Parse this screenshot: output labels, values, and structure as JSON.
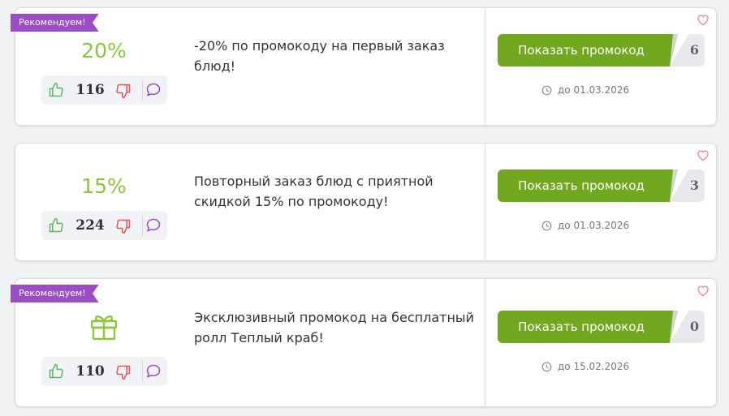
{
  "colors": {
    "accent_green": "#72a820",
    "discount_green": "#8cc63f",
    "ribbon_purple": "#9b4dc5",
    "like_green": "#5cb85c",
    "dislike_red": "#e05555",
    "comment_purple": "#9b4dc5",
    "heart_pink": "#e88a8a"
  },
  "coupons": [
    {
      "ribbon": "Рекомендуем!",
      "discount": "20%",
      "icon": "",
      "likes": "116",
      "description": "-20% по промокоду на первый заказ блюд!",
      "button_label": "Показать промокод",
      "code_hint": "6",
      "expiry": "до 01.03.2026"
    },
    {
      "ribbon": "",
      "discount": "15%",
      "icon": "",
      "likes": "224",
      "description": "Повторный заказ блюд с приятной скидкой 15% по промокоду!",
      "button_label": "Показать промокод",
      "code_hint": "3",
      "expiry": "до 01.03.2026"
    },
    {
      "ribbon": "Рекомендуем!",
      "discount": "",
      "icon": "gift-icon",
      "likes": "110",
      "description": "Эксклюзивный промокод на бесплатный ролл Теплый краб!",
      "button_label": "Показать промокод",
      "code_hint": "0",
      "expiry": "до 15.02.2026"
    }
  ]
}
